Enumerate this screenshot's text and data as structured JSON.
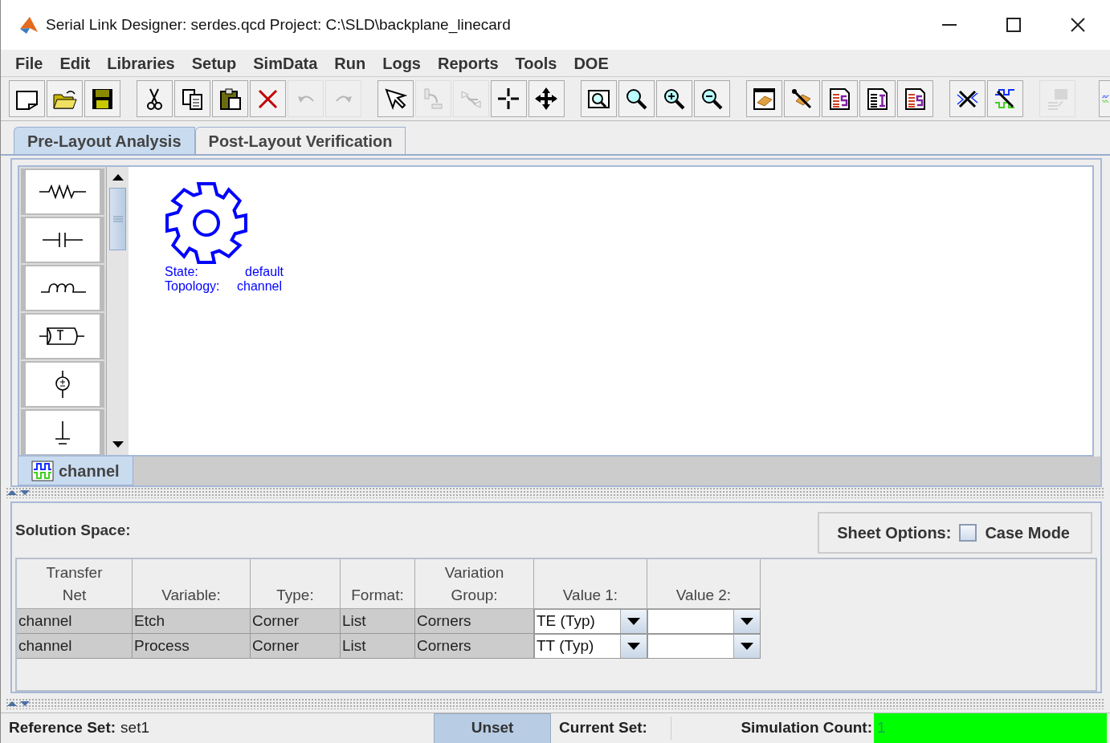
{
  "window": {
    "title": "Serial Link Designer: serdes.qcd Project: C:\\SLD\\backplane_linecard"
  },
  "menu": [
    "File",
    "Edit",
    "Libraries",
    "Setup",
    "SimData",
    "Run",
    "Logs",
    "Reports",
    "Tools",
    "DOE"
  ],
  "toolbar": [
    {
      "kind": "new",
      "disabled": false,
      "group_start": true
    },
    {
      "kind": "open",
      "disabled": false,
      "group_start": false
    },
    {
      "kind": "save",
      "disabled": false,
      "group_start": false
    },
    {
      "kind": "cut",
      "disabled": false,
      "group_start": true
    },
    {
      "kind": "copy",
      "disabled": false,
      "group_start": false
    },
    {
      "kind": "paste",
      "disabled": false,
      "group_start": false
    },
    {
      "kind": "delete",
      "disabled": false,
      "group_start": false
    },
    {
      "kind": "undo",
      "disabled": true,
      "group_start": false
    },
    {
      "kind": "redo",
      "disabled": true,
      "group_start": false
    },
    {
      "kind": "pointer",
      "disabled": false,
      "group_start": true
    },
    {
      "kind": "route",
      "disabled": true,
      "group_start": false
    },
    {
      "kind": "connect",
      "disabled": true,
      "group_start": false
    },
    {
      "kind": "crosshair",
      "disabled": false,
      "group_start": false
    },
    {
      "kind": "move",
      "disabled": false,
      "group_start": false
    },
    {
      "kind": "zoomfit",
      "disabled": false,
      "group_start": true
    },
    {
      "kind": "zoom",
      "disabled": false,
      "group_start": false
    },
    {
      "kind": "zoomin",
      "disabled": false,
      "group_start": false
    },
    {
      "kind": "zoomout",
      "disabled": false,
      "group_start": false
    },
    {
      "kind": "chip",
      "disabled": false,
      "group_start": true
    },
    {
      "kind": "chiptool",
      "disabled": false,
      "group_start": false
    },
    {
      "kind": "docs",
      "disabled": false,
      "group_start": false
    },
    {
      "kind": "doci",
      "disabled": false,
      "group_start": false
    },
    {
      "kind": "docs",
      "disabled": false,
      "group_start": false
    },
    {
      "kind": "wrenchwave",
      "disabled": false,
      "group_start": true
    },
    {
      "kind": "wrenchsignal",
      "disabled": false,
      "group_start": false
    },
    {
      "kind": "import",
      "disabled": true,
      "group_start": true
    },
    {
      "kind": "wave",
      "disabled": false,
      "group_start": true
    }
  ],
  "tabs": [
    {
      "label": "Pre-Layout Analysis",
      "selected": true
    },
    {
      "label": "Post-Layout Verification",
      "selected": false
    }
  ],
  "canvas": {
    "node": {
      "state_label": "State:",
      "state_value": "default",
      "topology_label": "Topology:",
      "topology_value": "channel"
    },
    "sheet_tabs": [
      {
        "label": "channel",
        "selected": true
      }
    ]
  },
  "solution_space": {
    "title": "Solution Space:",
    "sheet_options_label": "Sheet Options:",
    "case_mode": {
      "label": "Case Mode",
      "checked": false
    },
    "columns": [
      "Transfer\nNet",
      "Variable:",
      "Type:",
      "Format:",
      "Variation\nGroup:",
      "Value 1:",
      "Value 2:"
    ],
    "rows": [
      {
        "cells": [
          "channel",
          "Etch",
          "Corner",
          "List",
          "Corners"
        ],
        "value_1": "TE (Typ)"
      },
      {
        "cells": [
          "channel",
          "Process",
          "Corner",
          "List",
          "Corners"
        ],
        "value_1": "TT (Typ)"
      }
    ]
  },
  "status_bar": {
    "reference_set_label": "Reference Set:",
    "reference_set": "set1",
    "unset_button": "Unset",
    "current_set_label": "Current Set:",
    "simulation_count_label": "Simulation Count:",
    "simulation_count": "1"
  }
}
